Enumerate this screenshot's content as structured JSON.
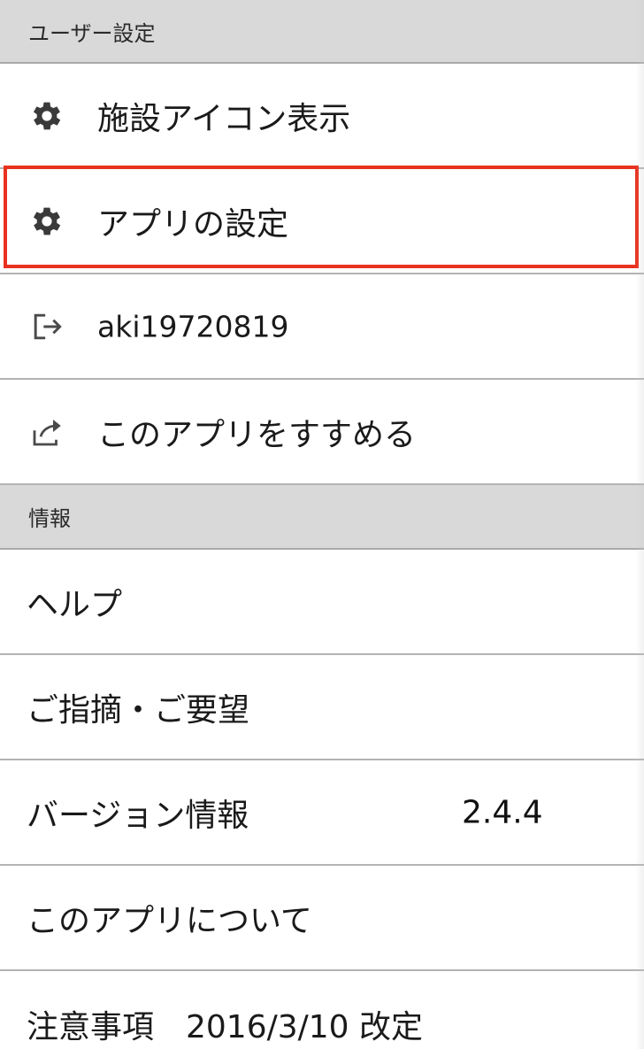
{
  "user_settings": {
    "header": "ユーザー設定",
    "items": [
      {
        "label": "施設アイコン表示",
        "icon": "gear-icon"
      },
      {
        "label": "アプリの設定",
        "icon": "gear-icon"
      },
      {
        "label": "aki19720819",
        "icon": "logout-icon"
      },
      {
        "label": "このアプリをすすめる",
        "icon": "share-icon"
      }
    ]
  },
  "info": {
    "header": "情報",
    "items": [
      {
        "label": "ヘルプ"
      },
      {
        "label": "ご指摘・ご要望"
      },
      {
        "label": "バージョン情報",
        "value": "2.4.4"
      },
      {
        "label": "このアプリについて"
      },
      {
        "label": "注意事項　2016/3/10 改定"
      }
    ]
  },
  "colors": {
    "highlight": "#e8321f",
    "header_bg": "#d9d9d9"
  }
}
